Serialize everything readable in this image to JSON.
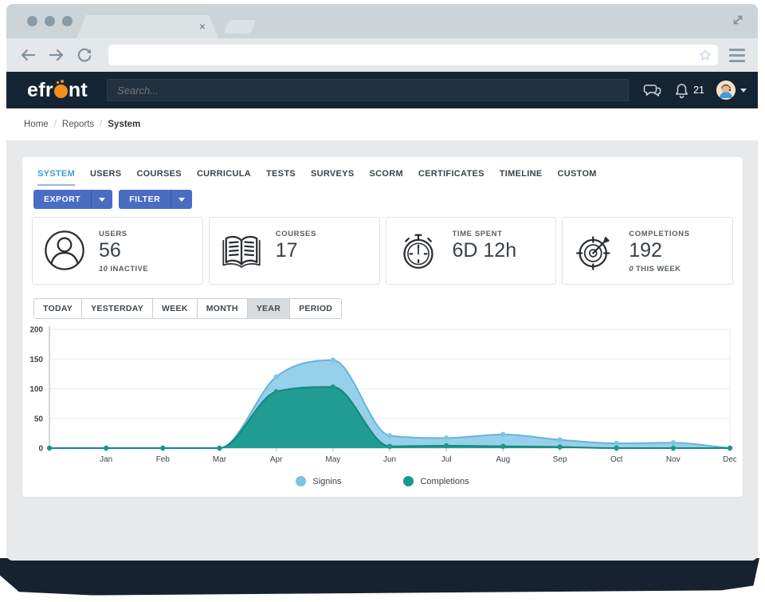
{
  "browser": {
    "close_icon": "×",
    "url_value": ""
  },
  "header": {
    "logo_pre": "efr",
    "logo_post": "nt",
    "search_placeholder": "Search...",
    "notification_count": "21"
  },
  "breadcrumb": {
    "home": "Home",
    "reports": "Reports",
    "current": "System",
    "separator": "/"
  },
  "tabs": [
    {
      "label": "SYSTEM",
      "active": true
    },
    {
      "label": "USERS"
    },
    {
      "label": "COURSES"
    },
    {
      "label": "CURRICULA"
    },
    {
      "label": "TESTS"
    },
    {
      "label": "SURVEYS"
    },
    {
      "label": "SCORM"
    },
    {
      "label": "CERTIFICATES"
    },
    {
      "label": "TIMELINE"
    },
    {
      "label": "CUSTOM"
    }
  ],
  "toolbar": {
    "export_label": "EXPORT",
    "filter_label": "FILTER"
  },
  "stats": [
    {
      "icon": "user-icon",
      "label": "USERS",
      "value": "56",
      "sub_num": "10",
      "sub_text": " INACTIVE"
    },
    {
      "icon": "book-icon",
      "label": "COURSES",
      "value": "17",
      "sub_num": "",
      "sub_text": ""
    },
    {
      "icon": "stopwatch-icon",
      "label": "TIME SPENT",
      "value": "6D 12h",
      "sub_num": "",
      "sub_text": ""
    },
    {
      "icon": "target-icon",
      "label": "COMPLETIONS",
      "value": "192",
      "sub_num": "0",
      "sub_text": " THIS WEEK"
    }
  ],
  "range": [
    {
      "label": "TODAY"
    },
    {
      "label": "YESTERDAY"
    },
    {
      "label": "WEEK"
    },
    {
      "label": "MONTH"
    },
    {
      "label": "YEAR",
      "active": true
    },
    {
      "label": "PERIOD"
    }
  ],
  "chart_data": {
    "type": "area",
    "x": [
      "",
      "Jan",
      "Feb",
      "Mar",
      "Apr",
      "May",
      "Jun",
      "Jul",
      "Aug",
      "Sep",
      "Oct",
      "Nov",
      "Dec"
    ],
    "series": [
      {
        "name": "Signins",
        "values": [
          0,
          0,
          0,
          0,
          120,
          148,
          21,
          17,
          23,
          14,
          8,
          9,
          0
        ],
        "color": "#66b4db",
        "fill": "rgba(125,196,229,0.8)",
        "swatch": "#7dc3e4"
      },
      {
        "name": "Completions",
        "values": [
          0,
          0,
          0,
          0,
          95,
          103,
          3,
          4,
          3,
          2,
          0,
          0,
          0
        ],
        "color": "#12887b",
        "fill": "rgba(23,152,140,0.93)",
        "swatch": "#17988a"
      }
    ],
    "ylim": [
      0,
      200
    ],
    "yticks": [
      0,
      50,
      100,
      150,
      200
    ],
    "grid": true,
    "legend_position": "bottom",
    "xlabel": "",
    "ylabel": ""
  }
}
